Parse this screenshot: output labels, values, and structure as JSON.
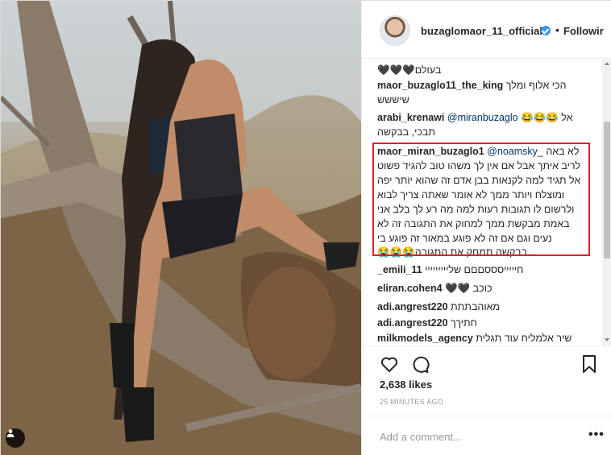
{
  "post": {
    "author": "buzaglomaor_11_official",
    "follow_label": "Followir",
    "dot": "•",
    "likes": "2,638 likes",
    "time": "25 MINUTES AGO",
    "comment_placeholder": "Add a comment...",
    "more_label": "•••"
  },
  "comments": [
    {
      "user": "",
      "text": "בעולם🖤🖤🖤"
    },
    {
      "user": "maor_buzaglo11_the_king",
      "text": "הכי אלוף ומלך",
      "text2": "שיששש"
    },
    {
      "user": "arabi_krenawi",
      "mention": "@miranbuzaglo",
      "text": "אל 😂😂😂",
      "text2": "תבכי, בבקשה"
    },
    {
      "user": "maor_miran_buzaglo1",
      "mention": "@noamsky_",
      "text": "לא באה",
      "lines": [
        "לריב איתך אבל אם אין לך משהו טוב להגיד פשוט",
        "אל תגיד למה לקנאות בבן אדם זה שהוא יותר יפה",
        "ומוצלח ויותר ממך לא אומר שאתה צריך לבוא",
        "ולרשום לו תגובות רעות למה מה רע לך בלב אני",
        "באמת מבקשת ממך למחוק את התגובה זה לא",
        "נעים וגם אם זה לא פוגע במאור זה פוגע בי",
        "...בבקשה תמחק את התגובה😭😭😭"
      ]
    },
    {
      "user": "_emili_11",
      "text": "חיייייסססםםם שלייייייייי"
    },
    {
      "user": "eliran.cohen4",
      "text": "כוכב 🖤🖤"
    },
    {
      "user": "adi.angrest220",
      "text": "מאוהבתתת"
    },
    {
      "user": "adi.angrest220",
      "text": "חתיךך"
    },
    {
      "user": "milkmodels_agency",
      "text": "שיר אלמליח עוד תגלית"
    }
  ],
  "colors": {
    "highlight": "#d8222c",
    "verified": "#3897f0",
    "mention": "#003569"
  },
  "icons": [
    "heart-icon",
    "comment-icon",
    "bookmark-icon",
    "user-tag-icon",
    "verified-icon"
  ]
}
